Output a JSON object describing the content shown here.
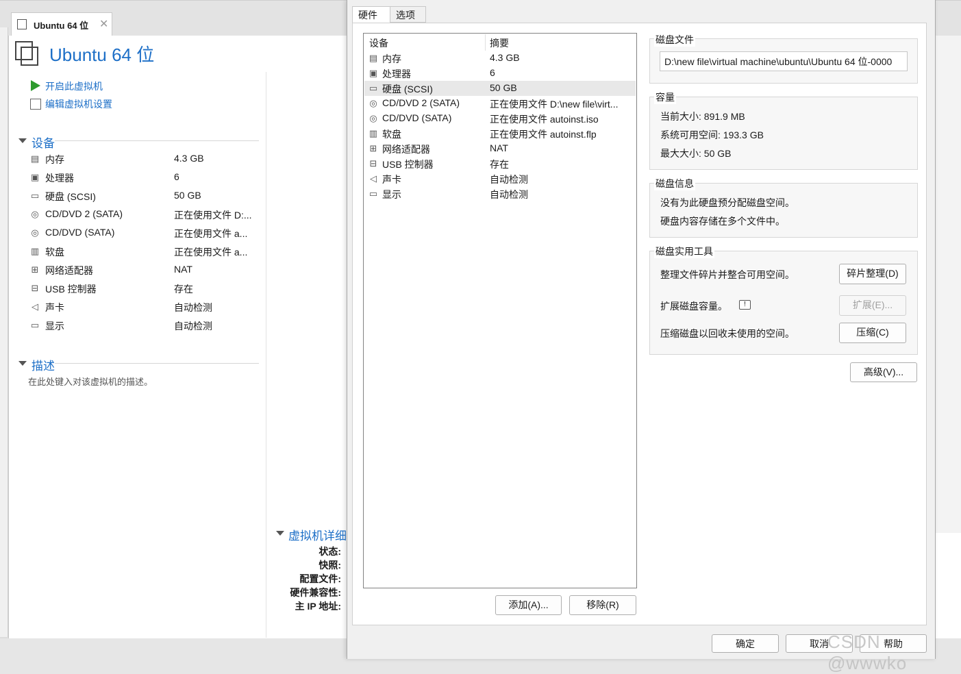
{
  "tab": {
    "label": "Ubuntu 64 位",
    "close": "✕"
  },
  "page": {
    "title": "Ubuntu 64 位"
  },
  "actions": {
    "power_on": "开启此虚拟机",
    "edit_settings": "编辑虚拟机设置"
  },
  "devices_section": {
    "title": "设备",
    "items": [
      {
        "icon": "memory-icon",
        "name": "内存",
        "value": "4.3 GB"
      },
      {
        "icon": "processor-icon",
        "name": "处理器",
        "value": "6"
      },
      {
        "icon": "hard-disk-icon",
        "name": "硬盘 (SCSI)",
        "value": "50 GB"
      },
      {
        "icon": "cd-dvd-icon",
        "name": "CD/DVD 2 (SATA)",
        "value": "正在使用文件 D:..."
      },
      {
        "icon": "cd-dvd-icon",
        "name": "CD/DVD (SATA)",
        "value": "正在使用文件 a..."
      },
      {
        "icon": "floppy-icon",
        "name": "软盘",
        "value": "正在使用文件 a..."
      },
      {
        "icon": "network-adapter-icon",
        "name": "网络适配器",
        "value": "NAT"
      },
      {
        "icon": "usb-icon",
        "name": "USB 控制器",
        "value": "存在"
      },
      {
        "icon": "sound-card-icon",
        "name": "声卡",
        "value": "自动检测"
      },
      {
        "icon": "display-icon",
        "name": "显示",
        "value": "自动检测"
      }
    ]
  },
  "description_section": {
    "title": "描述",
    "placeholder": "在此处键入对该虚拟机的描述。"
  },
  "vm_details": {
    "title": "虚拟机详细",
    "labels": [
      "状态:",
      "快照:",
      "配置文件:",
      "硬件兼容性:",
      "主 IP 地址:"
    ]
  },
  "dialog": {
    "tabs": [
      "硬件",
      "选项"
    ],
    "list_headers": {
      "device": "设备",
      "summary": "摘要"
    },
    "list": [
      {
        "icon": "memory-icon",
        "name": "内存",
        "summary": "4.3 GB"
      },
      {
        "icon": "processor-icon",
        "name": "处理器",
        "summary": "6"
      },
      {
        "icon": "hard-disk-icon",
        "name": "硬盘 (SCSI)",
        "summary": "50 GB",
        "selected": true
      },
      {
        "icon": "cd-dvd-icon",
        "name": "CD/DVD 2 (SATA)",
        "summary": "正在使用文件 D:\\new file\\virt..."
      },
      {
        "icon": "cd-dvd-icon",
        "name": "CD/DVD (SATA)",
        "summary": "正在使用文件 autoinst.iso"
      },
      {
        "icon": "floppy-icon",
        "name": "软盘",
        "summary": "正在使用文件 autoinst.flp"
      },
      {
        "icon": "network-adapter-icon",
        "name": "网络适配器",
        "summary": "NAT"
      },
      {
        "icon": "usb-icon",
        "name": "USB 控制器",
        "summary": "存在"
      },
      {
        "icon": "sound-card-icon",
        "name": "声卡",
        "summary": "自动检测"
      },
      {
        "icon": "display-icon",
        "name": "显示",
        "summary": "自动检测"
      }
    ],
    "add_button": "添加(A)...",
    "remove_button": "移除(R)",
    "disk_file": {
      "title": "磁盘文件",
      "path": "D:\\new file\\virtual machine\\ubuntu\\Ubuntu 64 位-0000"
    },
    "capacity": {
      "title": "容量",
      "current_size": "当前大小: 891.9 MB",
      "system_free": "系统可用空间: 193.3 GB",
      "max_size": "最大大小: 50 GB"
    },
    "disk_info": {
      "title": "磁盘信息",
      "line1": "没有为此硬盘预分配磁盘空间。",
      "line2": "硬盘内容存储在多个文件中。"
    },
    "disk_utilities": {
      "title": "磁盘实用工具",
      "defrag_text": "整理文件碎片并整合可用空间。",
      "defrag_button": "碎片整理(D)",
      "expand_text": "扩展磁盘容量。",
      "expand_button": "扩展(E)...",
      "compact_text": "压缩磁盘以回收未使用的空间。",
      "compact_button": "压缩(C)"
    },
    "advanced_button": "高级(V)...",
    "ok_button": "确定",
    "cancel_button": "取消",
    "help_button": "帮助"
  },
  "watermark": "CSDN @wwwko"
}
